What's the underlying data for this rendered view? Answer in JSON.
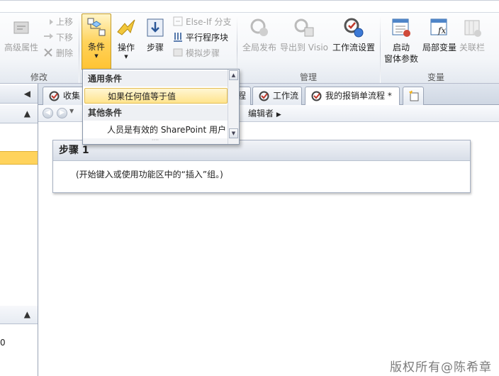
{
  "ribbon": {
    "edit_group": {
      "label": "修改",
      "advanced_properties": "高级属性",
      "move_up": "上移",
      "move_down": "下移",
      "delete": "删除"
    },
    "insert_group": {
      "condition": "条件",
      "action": "操作",
      "step": "步骤",
      "else_if_branch": "Else-If 分支",
      "parallel_block": "平行程序块",
      "impersonation_step": "模拟步骤"
    },
    "manage_group": {
      "label": "管理",
      "publish_globally": "全局发布",
      "export_to_visio": "导出到 Visio",
      "workflow_settings": "工作流设置"
    },
    "variables_group": {
      "label": "变量",
      "initiation_form_parameters_line1": "启动",
      "initiation_form_parameters_line2": "窗体参数",
      "local_variables": "局部变量",
      "association_columns": "关联栏"
    }
  },
  "tabs": [
    {
      "label": "收集"
    },
    {
      "label": "程"
    },
    {
      "label": "工作流"
    },
    {
      "label": "我的报销单流程 *"
    }
  ],
  "breadcrumb": {
    "editor": "编辑者"
  },
  "step": {
    "title": "步骤 1",
    "placeholder_text": "(开始键入或使用功能区中的“插入”组。)"
  },
  "condition_menu": {
    "common_header": "通用条件",
    "if_any_value_equals": "如果任何值等于值",
    "other_header": "其他条件",
    "person_is_valid_sp_user": "人员是有效的 SharePoint 用户"
  },
  "left_panel": {
    "bottom_text": "0"
  },
  "watermark": "版权所有@陈希章",
  "colors": {
    "highlight": "#ffd35c",
    "selected_row": "#ffe48d"
  }
}
